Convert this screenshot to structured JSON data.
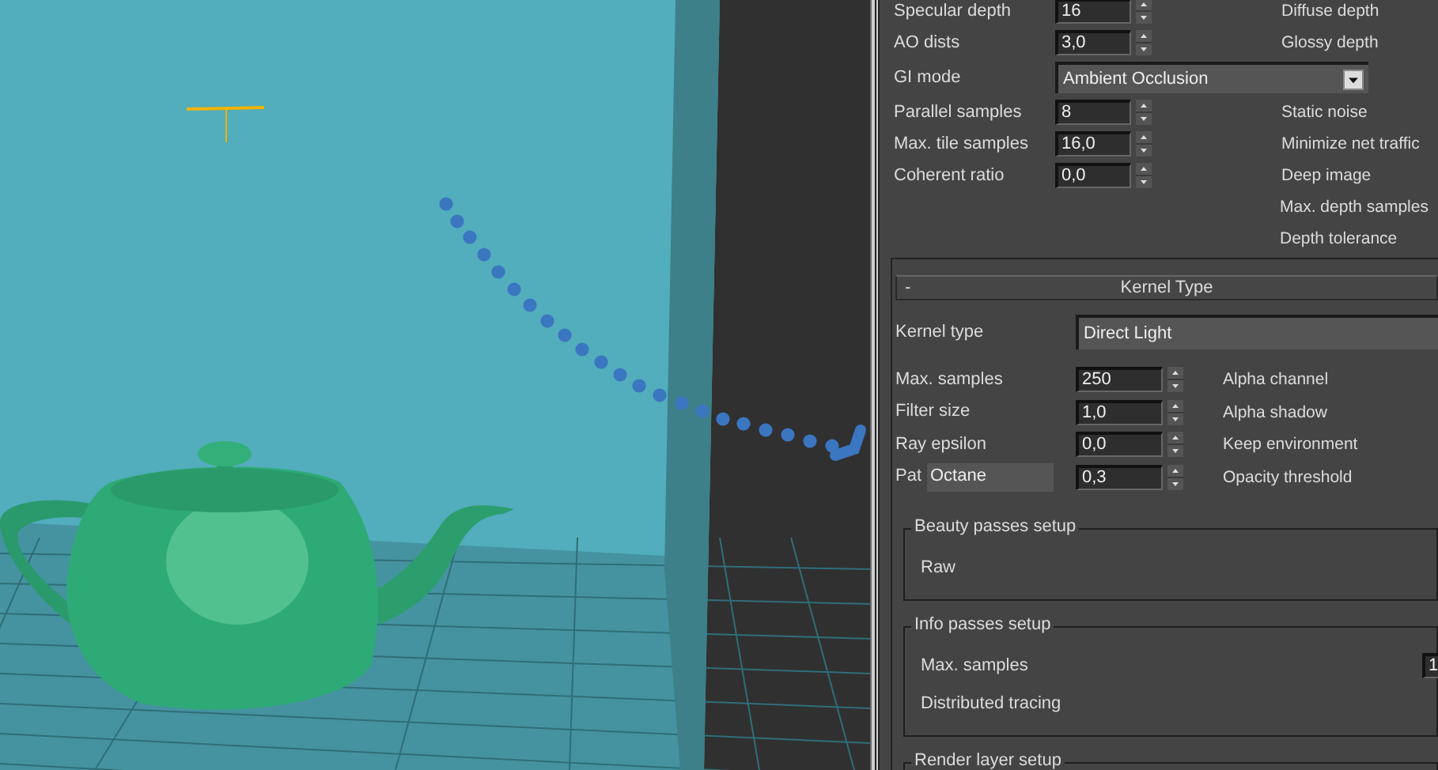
{
  "settings_rows": [
    {
      "kind": "spinner",
      "label": "Specular depth",
      "value": "16",
      "right_label": "Diffuse depth"
    },
    {
      "kind": "spinner",
      "label": "AO dists",
      "value": "3,0",
      "right_label": "Glossy depth"
    },
    {
      "kind": "dropdown",
      "label": "GI mode",
      "value": "Ambient Occlusion"
    },
    {
      "kind": "spinner",
      "label": "Parallel samples",
      "value": "8",
      "right_label": "Static noise"
    },
    {
      "kind": "spinner",
      "label": "Max. tile samples",
      "value": "16,0",
      "right_label": "Minimize net traffic"
    },
    {
      "kind": "spinner",
      "label": "Coherent ratio",
      "value": "0,0",
      "right_label": "Deep image"
    },
    {
      "kind": "right_only",
      "right_label": "Max. depth samples"
    },
    {
      "kind": "right_only",
      "right_label": "Depth tolerance"
    }
  ],
  "kernel_rollout": {
    "collapse_sign": "-",
    "title": "Kernel Type",
    "kernel_label": "Kernel type",
    "kernel_value": "Direct Light",
    "rows": [
      {
        "label": "Max. samples",
        "value": "250",
        "right_label": "Alpha channel"
      },
      {
        "label": "Filter size",
        "value": "1,0",
        "right_label": "Alpha shadow"
      },
      {
        "label": "Ray epsilon",
        "value": "0,0",
        "right_label": "Keep environment"
      },
      {
        "label": "Pat",
        "value": "0,3",
        "right_label": "Opacity threshold",
        "tooltip": "Octane"
      }
    ],
    "groups": [
      {
        "title": "Beauty passes setup",
        "items": [
          {
            "label": "Raw"
          }
        ]
      },
      {
        "title": "Info passes setup",
        "items": [
          {
            "label": "Max. samples",
            "value": "1"
          },
          {
            "label": "Distributed tracing"
          }
        ]
      },
      {
        "title": "Render layer setup"
      }
    ]
  }
}
